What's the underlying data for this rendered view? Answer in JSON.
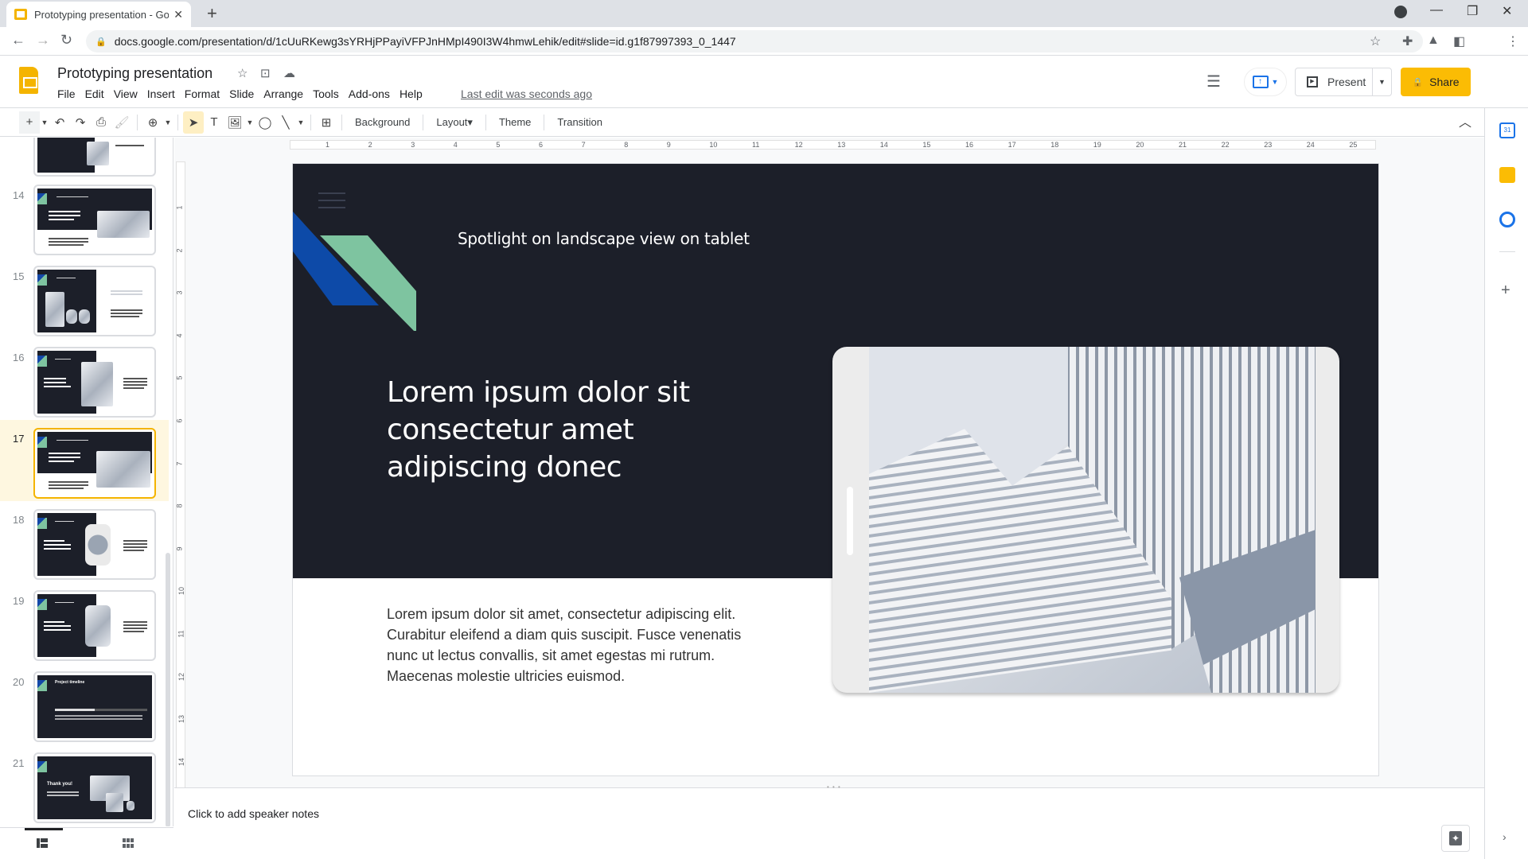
{
  "browser": {
    "tab_title": "Prototyping presentation - Goog",
    "new_tab_label": "+",
    "url": "docs.google.com/presentation/d/1cUuRKewg3sYRHjPPayiVFPJnHMpI490I3W4hmwLehik/edit#slide=id.g1f87997393_0_1447",
    "window_controls": [
      "minimize",
      "restore",
      "close"
    ]
  },
  "app": {
    "doc_title": "Prototyping presentation",
    "menu": [
      "File",
      "Edit",
      "View",
      "Insert",
      "Format",
      "Slide",
      "Arrange",
      "Tools",
      "Add-ons",
      "Help"
    ],
    "last_edit": "Last edit was seconds ago",
    "present_label": "Present",
    "share_label": "Share",
    "accent_color": "#fbbc04"
  },
  "toolbar": {
    "background_label": "Background",
    "layout_label": "Layout▾",
    "theme_label": "Theme",
    "transition_label": "Transition"
  },
  "filmstrip": {
    "active_slide": 17,
    "slides": [
      {
        "number": "14"
      },
      {
        "number": "15"
      },
      {
        "number": "16"
      },
      {
        "number": "17"
      },
      {
        "number": "18"
      },
      {
        "number": "19"
      },
      {
        "number": "20",
        "title": "Project timeline"
      },
      {
        "number": "21",
        "title": "Thank you!"
      }
    ]
  },
  "rulers": {
    "horizontal": [
      "1",
      "2",
      "3",
      "4",
      "5",
      "6",
      "7",
      "8",
      "9",
      "10",
      "11",
      "12",
      "13",
      "14",
      "15",
      "16",
      "17",
      "18",
      "19",
      "20",
      "21",
      "22",
      "23",
      "24",
      "25"
    ],
    "vertical": [
      "1",
      "2",
      "3",
      "4",
      "5",
      "6",
      "7",
      "8",
      "9",
      "10",
      "11",
      "12",
      "13",
      "14"
    ]
  },
  "slide": {
    "subtitle": "Spotlight on landscape view on tablet",
    "title": "Lorem ipsum dolor sit consectetur amet adipiscing donec",
    "body": "Lorem ipsum dolor sit amet, consectetur adipiscing elit. Curabitur eleifend a diam quis suscipit. Fusce venenatis nunc ut lectus convallis, sit amet egestas mi rutrum. Maecenas molestie ultricies euismod.",
    "dark_color": "#1c1f29",
    "ribbon_colors": [
      "#0d4aa8",
      "#7ec4a0"
    ]
  },
  "notes": {
    "placeholder": "Click to add speaker notes"
  }
}
